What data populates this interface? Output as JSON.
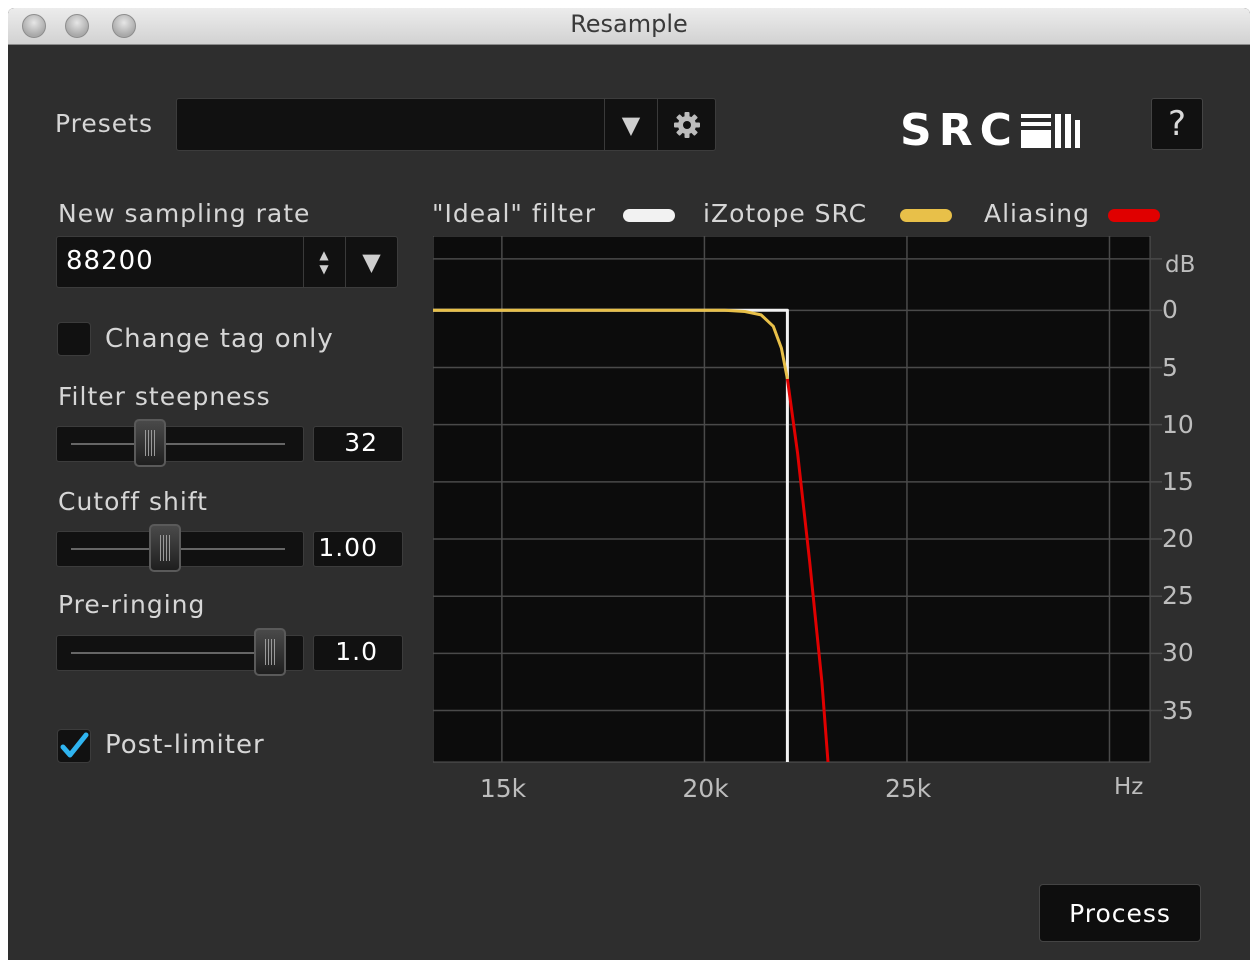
{
  "window": {
    "title": "Resample"
  },
  "presets": {
    "label": "Presets",
    "value": ""
  },
  "logo": {
    "text": "SRC"
  },
  "help": {
    "label": "?"
  },
  "sampling": {
    "label": "New sampling rate",
    "value": "88200"
  },
  "change_tag": {
    "label": "Change tag only",
    "checked": false
  },
  "filter_steepness": {
    "label": "Filter steepness",
    "value": "32",
    "level": 0.37
  },
  "cutoff_shift": {
    "label": "Cutoff shift",
    "value": "1.00",
    "level": 0.44
  },
  "pre_ringing": {
    "label": "Pre-ringing",
    "value": "1.0",
    "level": 0.93
  },
  "post_limiter": {
    "label": "Post-limiter",
    "checked": true
  },
  "process": {
    "label": "Process"
  },
  "chart_data": {
    "type": "line",
    "title": "",
    "x_unit_label": "Hz",
    "y_unit_label": "dB",
    "x_ticks": [
      "15k",
      "20k",
      "25k"
    ],
    "y_ticks": [
      "0",
      "5",
      "10",
      "15",
      "20",
      "25",
      "30",
      "35"
    ],
    "xlim": [
      13300,
      31000
    ],
    "ylim": [
      -39.5,
      6.5
    ],
    "grid": true,
    "legend": [
      "\"Ideal\" filter",
      "iZotope SRC",
      "Aliasing"
    ],
    "series": [
      {
        "name": "\"Ideal\" filter",
        "color": "#f2f2f2",
        "x": [
          13300,
          22050,
          22050
        ],
        "y": [
          0,
          0,
          -39.5
        ]
      },
      {
        "name": "iZotope SRC",
        "color": "#e8c049",
        "x": [
          13300,
          20500,
          21000,
          21400,
          21700,
          21900,
          22050
        ],
        "y": [
          0,
          0,
          -0.1,
          -0.4,
          -1.4,
          -3.3,
          -6
        ]
      },
      {
        "name": "Aliasing",
        "color": "#e00000",
        "x": [
          22050,
          22300,
          22600,
          22900,
          23050
        ],
        "y": [
          -6,
          -12.5,
          -22,
          -32.5,
          -39.5
        ]
      }
    ]
  }
}
